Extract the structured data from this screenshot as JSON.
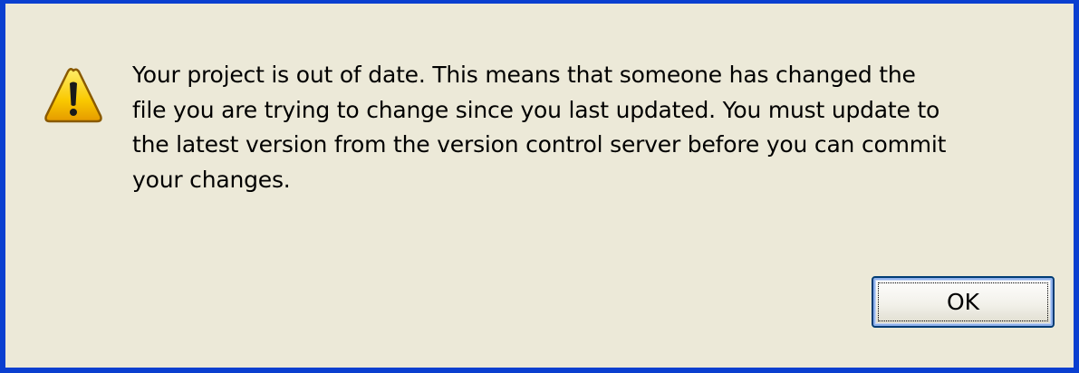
{
  "dialog": {
    "message_lines": [
      "Your project is out of date.  This means that someone has changed the",
      "file you are trying to change since you last updated.  You must update to",
      "the latest version from the version control server before you can commit",
      "your changes."
    ],
    "icon": "warning-icon",
    "ok_label": "OK"
  },
  "colors": {
    "window_border": "#0a3fd0",
    "dialog_background": "#ece9d8",
    "icon_yellow": "#f9c800"
  }
}
